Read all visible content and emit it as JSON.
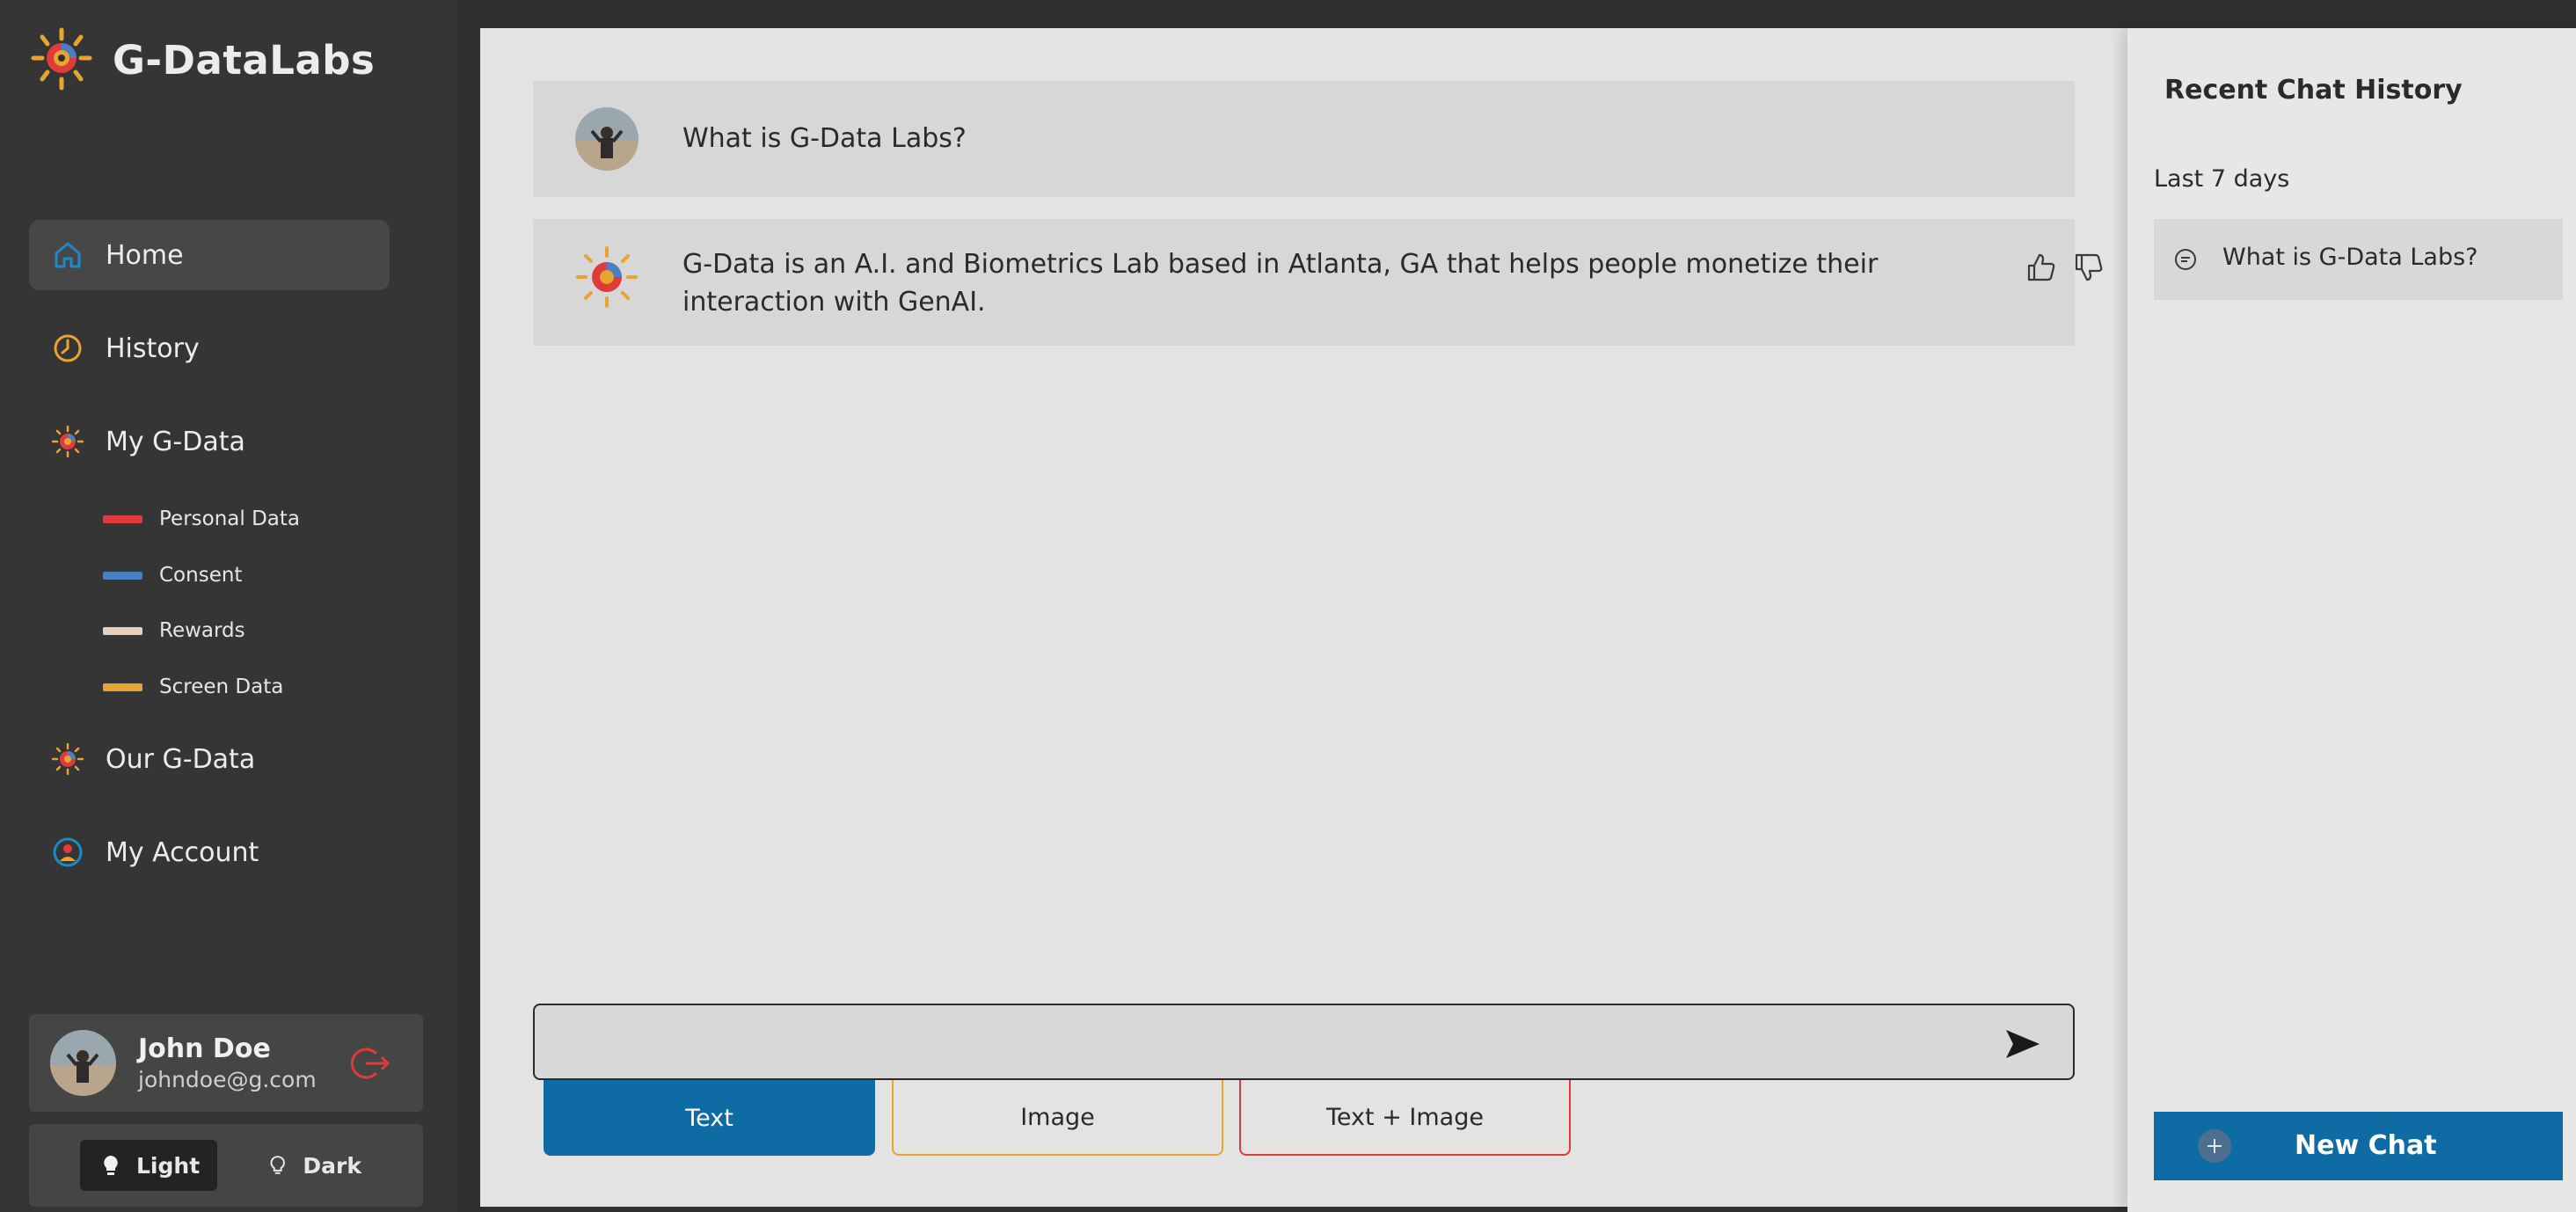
{
  "app": {
    "name": "G-DataLabs"
  },
  "sidebar": {
    "nav": [
      {
        "label": "Home",
        "icon": "home-icon"
      },
      {
        "label": "History",
        "icon": "history-icon"
      },
      {
        "label": "My G-Data",
        "icon": "gdata-logo-icon"
      },
      {
        "label": "Our G-Data",
        "icon": "gdata-logo-icon"
      },
      {
        "label": "My Account",
        "icon": "account-icon"
      }
    ],
    "sub_items": [
      {
        "label": "Personal Data",
        "color": "#e03a3a"
      },
      {
        "label": "Consent",
        "color": "#4a7fc0"
      },
      {
        "label": "Rewards",
        "color": "#e7cfc0"
      },
      {
        "label": "Screen Data",
        "color": "#e8a430"
      }
    ],
    "user": {
      "name": "John Doe",
      "email": "johndoe@g.com"
    },
    "theme": {
      "light_label": "Light",
      "dark_label": "Dark",
      "selected": "Light"
    }
  },
  "chat": {
    "question": "What is G-Data Labs?",
    "answer": "G-Data is an A.I. and Biometrics Lab based in Atlanta, GA that helps people monetize their interaction with GenAI.",
    "input": {
      "value": "",
      "placeholder": ""
    },
    "modes": {
      "text": "Text",
      "image": "Image",
      "both": "Text + Image",
      "selected": "Text"
    }
  },
  "history_panel": {
    "title": "Recent Chat History",
    "period": "Last 7 days",
    "items": [
      {
        "label": "What is G-Data Labs?"
      }
    ],
    "new_chat_label": "New Chat"
  },
  "colors": {
    "accent": "#0e6ba3",
    "sidebar_bg": "#353535",
    "main_bg": "#e3e3e1"
  }
}
